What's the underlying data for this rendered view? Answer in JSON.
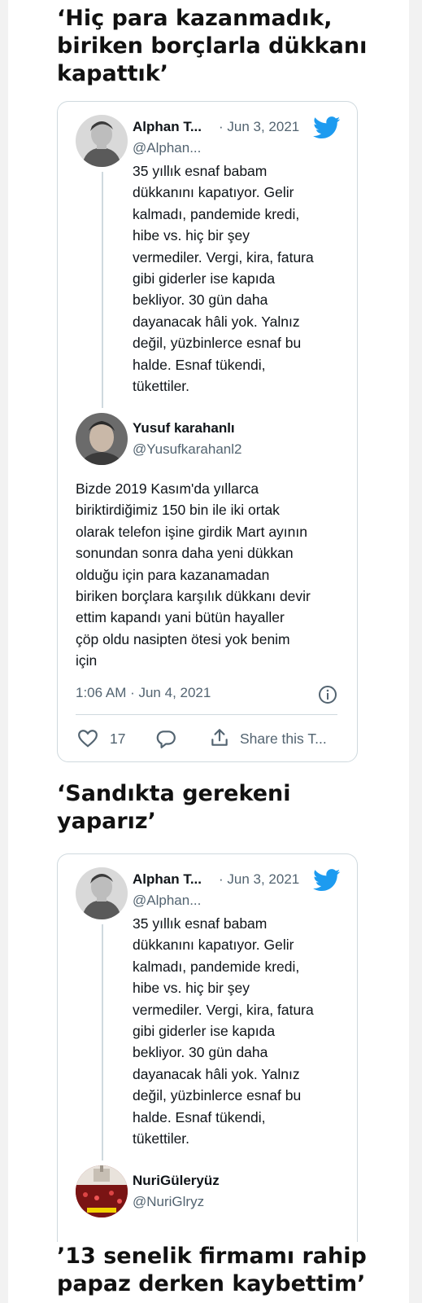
{
  "sections": [
    {
      "heading": "‘Hiç para kazanmadık, biriken borçlarla dükkanı kapattık’"
    },
    {
      "heading": "‘Sandıkta gerekeni yaparız’"
    },
    {
      "heading": "’13 senelik firmamı rahip papaz derken kaybettim’"
    }
  ],
  "tweet1": {
    "parent": {
      "name": "Alphan T...",
      "date": "· Jun 3, 2021",
      "handle": "@Alphan...",
      "text": "35 yıllık esnaf babam\ndükkanını kapatıyor. Gelir\nkalmadı, pandemide kredi,\nhibe vs. hiç bir şey\nvermediler. Vergi, kira, fatura\ngibi giderler ise kapıda\nbekliyor. 30 gün daha\ndayanacak hâli yok. Yalnız\ndeğil, yüzbinlerce esnaf bu\nhalde. Esnaf tükendi,\ntükettiler."
    },
    "reply": {
      "name": "Yusuf karahanlı",
      "handle": "@Yusufkarahanl2",
      "text": "Bizde 2019 Kasım'da yıllarca\nbiriktirdiğimiz 150 bin ile iki ortak\nolarak telefon işine girdik Mart ayının\nsonundan sonra daha yeni dükkan\nolduğu için para kazanamadan\nbiriken borçlara karşılık dükkanı devir\nettim kapandı yani bütün hayaller\nçöp oldu nasipten ötesi yok benim\niçin",
      "timestamp": "1:06 AM · Jun 4, 2021"
    },
    "actions": {
      "likes": "17",
      "share": "Share this T..."
    }
  },
  "tweet2": {
    "parent": {
      "name": "Alphan T...",
      "date": "· Jun 3, 2021",
      "handle": "@Alphan...",
      "text": "35 yıllık esnaf babam\ndükkanını kapatıyor. Gelir\nkalmadı, pandemide kredi,\nhibe vs. hiç bir şey\nvermediler. Vergi, kira, fatura\ngibi giderler ise kapıda\nbekliyor. 30 gün daha\ndayanacak hâli yok. Yalnız\ndeğil, yüzbinlerce esnaf bu\nhalde. Esnaf tükendi,\ntükettiler."
    },
    "reply": {
      "name": "NuriGüleryüz",
      "handle": "@NuriGlryz"
    }
  },
  "colors": {
    "twitter_blue": "#1d9bf0",
    "muted_text": "#536471",
    "border": "#cfd9de",
    "heart_icon": "#536471"
  },
  "icons": [
    "twitter-bird-icon",
    "info-icon",
    "heart-icon",
    "reply-icon",
    "share-icon"
  ]
}
